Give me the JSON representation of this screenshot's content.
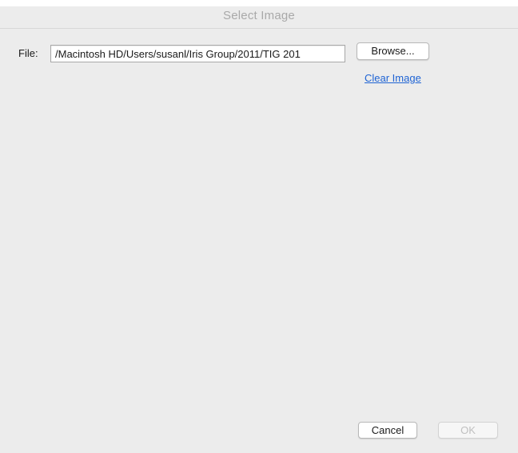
{
  "dialog": {
    "title": "Select Image"
  },
  "file": {
    "label": "File:",
    "value": "/Macintosh HD/Users/susanl/Iris Group/2011/TIG 201"
  },
  "actions": {
    "browse_label": "Browse...",
    "clear_label": "Clear Image",
    "cancel_label": "Cancel",
    "ok_label": "OK"
  },
  "colors": {
    "window_background": "#ececec",
    "link": "#1e63d4",
    "title_text": "#a9a9a9",
    "disabled_text": "#c0c0c0"
  }
}
